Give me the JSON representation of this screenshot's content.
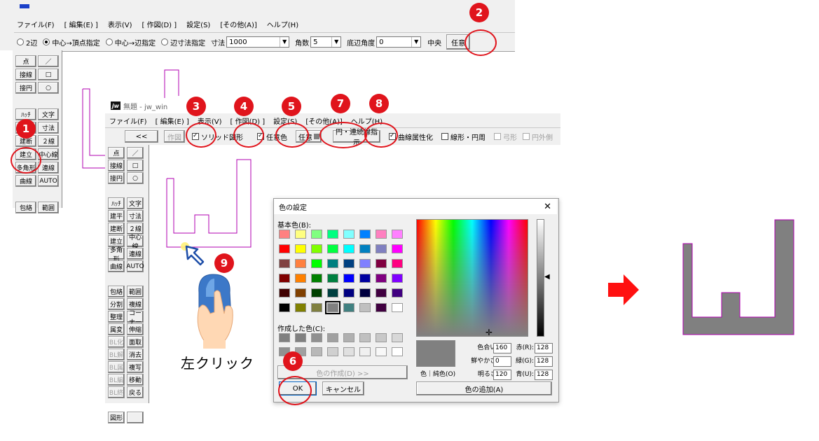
{
  "back_window": {
    "menu": [
      "ファイル(F)",
      "[ 編集(E) ]",
      "表示(V)",
      "[ 作図(D) ]",
      "設定(S)",
      "[その他(A)]",
      "ヘルプ(H)"
    ],
    "options": {
      "r1": "2辺",
      "r2": "中心→頂点指定",
      "r3": "中心→辺指定",
      "r4": "辺寸法指定",
      "size_label": "寸法",
      "size_value": "1000",
      "corners_label": "角数",
      "corners_value": "5",
      "angle_label": "底辺角度",
      "angle_value": "0",
      "center_button": "中央",
      "any_button": "任意"
    },
    "palette": [
      "点",
      "／",
      "接線",
      "□",
      "接円",
      "○",
      "ﾊｯﾁ",
      "文字",
      "建平",
      "寸法",
      "建断",
      "２線",
      "建立",
      "中心線",
      "多角形",
      "連線",
      "曲線",
      "AUTO",
      "包絡",
      "範囲"
    ]
  },
  "front_window": {
    "title": "無題 - jw_win",
    "logo": "jw",
    "menu": [
      "ファイル(F)",
      "[ 編集(E) ]",
      "表示(V)",
      "[ 作図(D) ]",
      "設定(S)",
      "[その他(A)]",
      "ヘルプ(H)"
    ],
    "toolbar": {
      "back": "<<",
      "draw": "作図",
      "solid": "ソリッド図形",
      "any_color": "任意色",
      "any_button": "任意",
      "continuous": "円・連続線指示",
      "curve": "曲線属性化",
      "line_circle": "線形・円周",
      "arc": "弓形",
      "outer": "円外側"
    },
    "palette": [
      "点",
      "／",
      "接線",
      "□",
      "接円",
      "○",
      "ﾊｯﾁ",
      "文字",
      "建平",
      "寸法",
      "建断",
      "２線",
      "建立",
      "中心線",
      "多角形",
      "連線",
      "曲線",
      "AUTO",
      "包絡",
      "範囲",
      "分割",
      "複線",
      "整理",
      "コーナー",
      "属変",
      "伸縮",
      "BL化",
      "面取",
      "BL解",
      "消去",
      "BL属",
      "複写",
      "BL編",
      "移動",
      "BL終",
      "戻る",
      "図形",
      ""
    ]
  },
  "color_dialog": {
    "title": "色の設定",
    "basic_label": "基本色(B):",
    "custom_label": "作成した色(C):",
    "define_button": "色の作成(D) >>",
    "ok": "OK",
    "cancel": "キャンセル",
    "add_button": "色の追加(A)",
    "solid_label": "色｜純色(O)",
    "hue_label": "色合い(E):",
    "hue": "160",
    "sat_label": "鮮やかさ(S):",
    "sat": "0",
    "lum_label": "明るさ(L):",
    "lum": "120",
    "red_label": "赤(R):",
    "red": "128",
    "green_label": "緑(G):",
    "green": "128",
    "blue_label": "青(U):",
    "blue": "128",
    "basic_colors": [
      "#ff8080",
      "#ffff80",
      "#80ff80",
      "#00ff80",
      "#80ffff",
      "#0080ff",
      "#ff80c0",
      "#ff80ff",
      "#ff0000",
      "#ffff00",
      "#80ff00",
      "#00ff40",
      "#00ffff",
      "#0080c0",
      "#8080c0",
      "#ff00ff",
      "#804040",
      "#ff8040",
      "#00ff00",
      "#008080",
      "#004080",
      "#8080ff",
      "#800040",
      "#ff0080",
      "#800000",
      "#ff8000",
      "#008000",
      "#008040",
      "#0000ff",
      "#0000a0",
      "#800080",
      "#8000ff",
      "#400000",
      "#804000",
      "#004000",
      "#004040",
      "#000080",
      "#000040",
      "#400040",
      "#400080",
      "#000000",
      "#808000",
      "#808040",
      "#808080",
      "#408080",
      "#c0c0c0",
      "#400040",
      "#ffffff"
    ],
    "custom_colors": [
      "#808080",
      "#808080",
      "#909090",
      "#a0a0a0",
      "#b0b0b0",
      "#c0c0c0",
      "#c8c8c8",
      "#d8d8d8",
      "#909090",
      "#a0a0a0",
      "#b8b8b8",
      "#d0d0d0",
      "#e0e0e0",
      "#f0f0f0",
      "#f8f8f8",
      "#ffffff"
    ],
    "preview_color": "#808080"
  },
  "annotation": {
    "click_label": "左クリック",
    "numbers": [
      "1",
      "2",
      "3",
      "4",
      "5",
      "6",
      "7",
      "8",
      "9"
    ],
    "accent": "#e0141c",
    "shape_color": "#808080",
    "outline_color": "#b000b0"
  }
}
